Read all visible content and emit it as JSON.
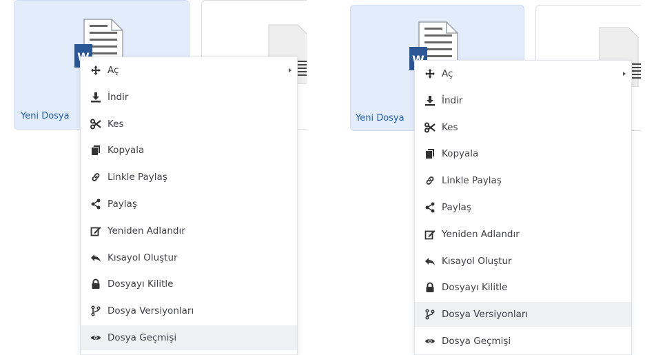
{
  "colors": {
    "selected_card_bg": "#e3ecfb",
    "file_label": "#1f5fae",
    "word_blue": "#2b5797",
    "icon_dark": "#333333",
    "menu_highlight": "#eff0f2"
  },
  "file": {
    "name": "Yeni Dosya",
    "icon": "word-document-icon"
  },
  "context_menu": {
    "items": [
      {
        "label": "Aç",
        "icon": "move-arrows-icon",
        "has_submenu": true
      },
      {
        "label": "İndir",
        "icon": "download-icon"
      },
      {
        "label": "Kes",
        "icon": "scissors-icon"
      },
      {
        "label": "Kopyala",
        "icon": "copy-icon"
      },
      {
        "label": "Linkle Paylaş",
        "icon": "link-icon"
      },
      {
        "label": "Paylaş",
        "icon": "share-icon"
      },
      {
        "label": "Yeniden Adlandır",
        "icon": "edit-icon"
      },
      {
        "label": "Kısayol Oluştur",
        "icon": "reply-arrow-icon"
      },
      {
        "label": "Dosyayı Kilitle",
        "icon": "lock-icon"
      },
      {
        "label": "Dosya Versiyonları",
        "icon": "code-branch-icon"
      },
      {
        "label": "Dosya Geçmişi",
        "icon": "eye-icon"
      }
    ]
  },
  "panels": [
    {
      "highlighted_item": "Dosya Geçmişi"
    },
    {
      "highlighted_item": "Dosya Versiyonları"
    }
  ]
}
